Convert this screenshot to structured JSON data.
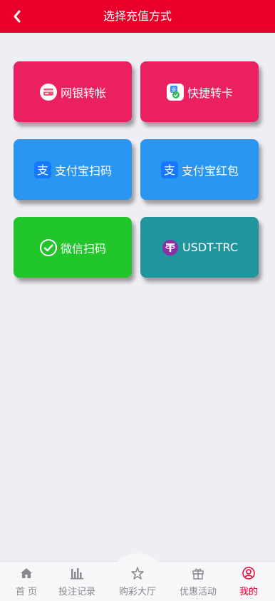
{
  "header": {
    "title": "选择充值方式"
  },
  "methods": [
    {
      "label": "网银转帐",
      "color": "#ea2060",
      "icon": "bank-card-icon"
    },
    {
      "label": "快捷转卡",
      "color": "#ea2060",
      "icon": "quick-transfer-icon"
    },
    {
      "label": "支付宝扫码",
      "color": "#2a96f2",
      "icon": "alipay-icon"
    },
    {
      "label": "支付宝红包",
      "color": "#2a96f2",
      "icon": "alipay-icon"
    },
    {
      "label": "微信扫码",
      "color": "#20c62a",
      "icon": "wechat-check-icon"
    },
    {
      "label": "USDT-TRC",
      "color": "#20959e",
      "icon": "tether-icon"
    }
  ],
  "tabs": [
    {
      "label": "首 页",
      "icon": "home-icon"
    },
    {
      "label": "投注记录",
      "icon": "bar-chart-icon"
    },
    {
      "label": "购彩大厅",
      "icon": "star-icon"
    },
    {
      "label": "优惠活动",
      "icon": "gift-icon"
    },
    {
      "label": "我的",
      "icon": "user-icon",
      "active": true
    }
  ],
  "colors": {
    "brand": "#e8002a",
    "background": "#eeeef4"
  }
}
